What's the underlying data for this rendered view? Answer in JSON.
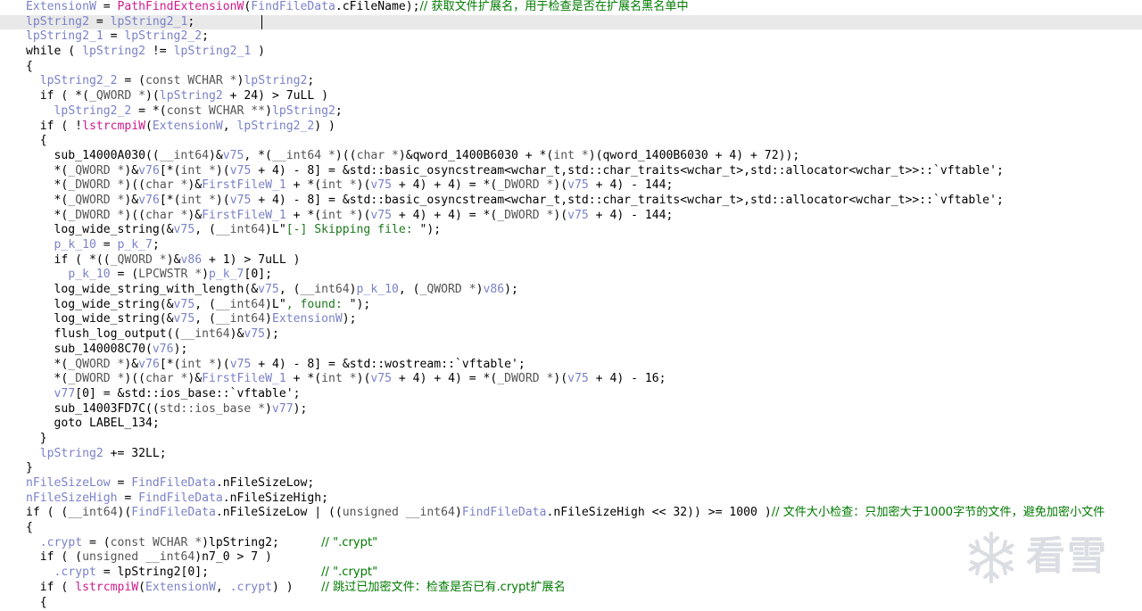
{
  "editor": {
    "current_line_index": 1,
    "lines": [
      [
        [
          "ExtensionW",
          "var"
        ],
        [
          " = ",
          "plain"
        ],
        [
          "PathFindExtensionW",
          "api"
        ],
        [
          "(",
          "plain"
        ],
        [
          "FindFileData",
          "var"
        ],
        [
          ".cFileName);",
          "plain"
        ],
        [
          "// 获取文件扩展名，用于检查是否在扩展名黑名单中",
          "comment"
        ]
      ],
      [
        [
          "lpString2",
          "var"
        ],
        [
          " = ",
          "plain"
        ],
        [
          "lpString2_1",
          "var"
        ],
        [
          ";",
          "plain"
        ]
      ],
      [
        [
          "lpString2_1",
          "var"
        ],
        [
          " = ",
          "plain"
        ],
        [
          "lpString2_2",
          "var"
        ],
        [
          ";",
          "plain"
        ]
      ],
      [
        [
          "while ( ",
          "plain"
        ],
        [
          "lpString2",
          "var"
        ],
        [
          " != ",
          "plain"
        ],
        [
          "lpString2_1",
          "var"
        ],
        [
          " )",
          "plain"
        ]
      ],
      [
        [
          "{",
          "plain"
        ]
      ],
      [
        [
          "  ",
          "plain"
        ],
        [
          "lpString2_2",
          "var"
        ],
        [
          " = (",
          "plain"
        ],
        [
          "const WCHAR *",
          "type"
        ],
        [
          ")",
          "plain"
        ],
        [
          "lpString2",
          "var"
        ],
        [
          ";",
          "plain"
        ]
      ],
      [
        [
          "  if ( *(",
          "plain"
        ],
        [
          "_QWORD *",
          "type"
        ],
        [
          ")(",
          "plain"
        ],
        [
          "lpString2",
          "var"
        ],
        [
          " + 24) > 7uLL )",
          "plain"
        ]
      ],
      [
        [
          "    ",
          "plain"
        ],
        [
          "lpString2_2",
          "var"
        ],
        [
          " = *(",
          "plain"
        ],
        [
          "const WCHAR **",
          "type"
        ],
        [
          ")",
          "plain"
        ],
        [
          "lpString2",
          "var"
        ],
        [
          ";",
          "plain"
        ]
      ],
      [
        [
          "  if ( !",
          "plain"
        ],
        [
          "lstrcmpiW",
          "api"
        ],
        [
          "(",
          "plain"
        ],
        [
          "ExtensionW",
          "var"
        ],
        [
          ", ",
          "plain"
        ],
        [
          "lpString2_2",
          "var"
        ],
        [
          ") )",
          "plain"
        ]
      ],
      [
        [
          "  {",
          "plain"
        ]
      ],
      [
        [
          "    sub_14000A030((",
          "plain"
        ],
        [
          "__int64",
          "type"
        ],
        [
          ")&",
          "plain"
        ],
        [
          "v75",
          "var"
        ],
        [
          ", *(",
          "plain"
        ],
        [
          "__int64 *",
          "type"
        ],
        [
          ")((",
          "plain"
        ],
        [
          "char *",
          "type"
        ],
        [
          ")&qword_1400B6030 + *(",
          "plain"
        ],
        [
          "int *",
          "type"
        ],
        [
          ")(qword_1400B6030 + 4) + 72));",
          "plain"
        ]
      ],
      [
        [
          "    *(",
          "plain"
        ],
        [
          "_QWORD *",
          "type"
        ],
        [
          ")&",
          "plain"
        ],
        [
          "v76",
          "var"
        ],
        [
          "[*(",
          "plain"
        ],
        [
          "int *",
          "type"
        ],
        [
          ")(",
          "plain"
        ],
        [
          "v75",
          "var"
        ],
        [
          " + 4) - 8] = &std::basic_osyncstream<wchar_t,std::char_traits<wchar_t>,std::allocator<wchar_t>>::`vftable';",
          "plain"
        ]
      ],
      [
        [
          "    *(",
          "plain"
        ],
        [
          "_DWORD *",
          "type"
        ],
        [
          ")((",
          "plain"
        ],
        [
          "char *",
          "type"
        ],
        [
          ")&",
          "plain"
        ],
        [
          "FirstFileW_1",
          "var"
        ],
        [
          " + *(",
          "plain"
        ],
        [
          "int *",
          "type"
        ],
        [
          ")(",
          "plain"
        ],
        [
          "v75",
          "var"
        ],
        [
          " + 4) + 4) = *(",
          "plain"
        ],
        [
          "_DWORD *",
          "type"
        ],
        [
          ")(",
          "plain"
        ],
        [
          "v75",
          "var"
        ],
        [
          " + 4) - 144;",
          "plain"
        ]
      ],
      [
        [
          "    *(",
          "plain"
        ],
        [
          "_QWORD *",
          "type"
        ],
        [
          ")&",
          "plain"
        ],
        [
          "v76",
          "var"
        ],
        [
          "[*(",
          "plain"
        ],
        [
          "int *",
          "type"
        ],
        [
          ")(",
          "plain"
        ],
        [
          "v75",
          "var"
        ],
        [
          " + 4) - 8] = &std::basic_osyncstream<wchar_t,std::char_traits<wchar_t>,std::allocator<wchar_t>>::`vftable';",
          "plain"
        ]
      ],
      [
        [
          "    *(",
          "plain"
        ],
        [
          "_DWORD *",
          "type"
        ],
        [
          ")((",
          "plain"
        ],
        [
          "char *",
          "type"
        ],
        [
          ")&",
          "plain"
        ],
        [
          "FirstFileW_1",
          "var"
        ],
        [
          " + *(",
          "plain"
        ],
        [
          "int *",
          "type"
        ],
        [
          ")(",
          "plain"
        ],
        [
          "v75",
          "var"
        ],
        [
          " + 4) + 4) = *(",
          "plain"
        ],
        [
          "_DWORD *",
          "type"
        ],
        [
          ")(",
          "plain"
        ],
        [
          "v75",
          "var"
        ],
        [
          " + 4) - 144;",
          "plain"
        ]
      ],
      [
        [
          "    log_wide_string(&",
          "plain"
        ],
        [
          "v75",
          "var"
        ],
        [
          ", (",
          "plain"
        ],
        [
          "__int64",
          "type"
        ],
        [
          ")L\"",
          "plain"
        ],
        [
          "[-] Skipping file: ",
          "str"
        ],
        [
          "\");",
          "plain"
        ]
      ],
      [
        [
          "    ",
          "plain"
        ],
        [
          "p_k_10",
          "var"
        ],
        [
          " = ",
          "plain"
        ],
        [
          "p_k_7",
          "var"
        ],
        [
          ";",
          "plain"
        ]
      ],
      [
        [
          "    if ( *((",
          "plain"
        ],
        [
          "_QWORD *",
          "type"
        ],
        [
          ")&",
          "plain"
        ],
        [
          "v86",
          "var"
        ],
        [
          " + 1) > 7uLL )",
          "plain"
        ]
      ],
      [
        [
          "      ",
          "plain"
        ],
        [
          "p_k_10",
          "var"
        ],
        [
          " = (",
          "plain"
        ],
        [
          "LPCWSTR *",
          "type"
        ],
        [
          ")",
          "plain"
        ],
        [
          "p_k_7",
          "var"
        ],
        [
          "[0];",
          "plain"
        ]
      ],
      [
        [
          "    log_wide_string_with_length(&",
          "plain"
        ],
        [
          "v75",
          "var"
        ],
        [
          ", (",
          "plain"
        ],
        [
          "__int64",
          "type"
        ],
        [
          ")",
          "plain"
        ],
        [
          "p_k_10",
          "var"
        ],
        [
          ", (",
          "plain"
        ],
        [
          "_QWORD *",
          "type"
        ],
        [
          ")",
          "plain"
        ],
        [
          "v86",
          "var"
        ],
        [
          ");",
          "plain"
        ]
      ],
      [
        [
          "    log_wide_string(&",
          "plain"
        ],
        [
          "v75",
          "var"
        ],
        [
          ", (",
          "plain"
        ],
        [
          "__int64",
          "type"
        ],
        [
          ")L\"",
          "plain"
        ],
        [
          ", found: ",
          "str"
        ],
        [
          "\");",
          "plain"
        ]
      ],
      [
        [
          "    log_wide_string(&",
          "plain"
        ],
        [
          "v75",
          "var"
        ],
        [
          ", (",
          "plain"
        ],
        [
          "__int64",
          "type"
        ],
        [
          ")",
          "plain"
        ],
        [
          "ExtensionW",
          "var"
        ],
        [
          ");",
          "plain"
        ]
      ],
      [
        [
          "    flush_log_output((",
          "plain"
        ],
        [
          "__int64",
          "type"
        ],
        [
          ")&",
          "plain"
        ],
        [
          "v75",
          "var"
        ],
        [
          ");",
          "plain"
        ]
      ],
      [
        [
          "    sub_140008C70(",
          "plain"
        ],
        [
          "v76",
          "var"
        ],
        [
          ");",
          "plain"
        ]
      ],
      [
        [
          "    *(",
          "plain"
        ],
        [
          "_QWORD *",
          "type"
        ],
        [
          ")&",
          "plain"
        ],
        [
          "v76",
          "var"
        ],
        [
          "[*(",
          "plain"
        ],
        [
          "int *",
          "type"
        ],
        [
          ")(",
          "plain"
        ],
        [
          "v75",
          "var"
        ],
        [
          " + 4) - 8] = &std::wostream::`vftable';",
          "plain"
        ]
      ],
      [
        [
          "    *(",
          "plain"
        ],
        [
          "_DWORD *",
          "type"
        ],
        [
          ")((",
          "plain"
        ],
        [
          "char *",
          "type"
        ],
        [
          ")&",
          "plain"
        ],
        [
          "FirstFileW_1",
          "var"
        ],
        [
          " + *(",
          "plain"
        ],
        [
          "int *",
          "type"
        ],
        [
          ")(",
          "plain"
        ],
        [
          "v75",
          "var"
        ],
        [
          " + 4) + 4) = *(",
          "plain"
        ],
        [
          "_DWORD *",
          "type"
        ],
        [
          ")(",
          "plain"
        ],
        [
          "v75",
          "var"
        ],
        [
          " + 4) - 16;",
          "plain"
        ]
      ],
      [
        [
          "    ",
          "plain"
        ],
        [
          "v77",
          "var"
        ],
        [
          "[0] = &std::ios_base::`vftable';",
          "plain"
        ]
      ],
      [
        [
          "    sub_14003FD7C((",
          "plain"
        ],
        [
          "std::ios_base *",
          "type"
        ],
        [
          ")",
          "plain"
        ],
        [
          "v77",
          "var"
        ],
        [
          ");",
          "plain"
        ]
      ],
      [
        [
          "    goto LABEL_134;",
          "plain"
        ]
      ],
      [
        [
          "  }",
          "plain"
        ]
      ],
      [
        [
          "  ",
          "plain"
        ],
        [
          "lpString2",
          "var"
        ],
        [
          " += 32LL;",
          "plain"
        ]
      ],
      [
        [
          "}",
          "plain"
        ]
      ],
      [
        [
          "nFileSizeLow",
          "var"
        ],
        [
          " = ",
          "plain"
        ],
        [
          "FindFileData",
          "var"
        ],
        [
          ".nFileSizeLow;",
          "plain"
        ]
      ],
      [
        [
          "nFileSizeHigh",
          "var"
        ],
        [
          " = ",
          "plain"
        ],
        [
          "FindFileData",
          "var"
        ],
        [
          ".nFileSizeHigh;",
          "plain"
        ]
      ],
      [
        [
          "if ( (",
          "plain"
        ],
        [
          "__int64",
          "type"
        ],
        [
          ")(",
          "plain"
        ],
        [
          "FindFileData",
          "var"
        ],
        [
          ".nFileSizeLow | ((",
          "plain"
        ],
        [
          "unsigned __int64",
          "type"
        ],
        [
          ")",
          "plain"
        ],
        [
          "FindFileData",
          "var"
        ],
        [
          ".nFileSizeHigh << 32)) >= 1000 )",
          "plain"
        ],
        [
          "// 文件大小检查：只加密大于1000字节的文件，避免加密小文件",
          "comment"
        ]
      ],
      [
        [
          "{",
          "plain"
        ]
      ],
      [
        [
          "  ",
          "plain"
        ],
        [
          ".crypt",
          "var"
        ],
        [
          " = (",
          "plain"
        ],
        [
          "const WCHAR *",
          "type"
        ],
        [
          ")lpString2;      ",
          "plain"
        ],
        [
          "// \".crypt\"",
          "comment"
        ]
      ],
      [
        [
          "  if ( (",
          "plain"
        ],
        [
          "unsigned __int64",
          "type"
        ],
        [
          ")n7_0 > 7 )",
          "plain"
        ]
      ],
      [
        [
          "    ",
          "plain"
        ],
        [
          ".crypt",
          "var"
        ],
        [
          " = lpString2[0];                ",
          "plain"
        ],
        [
          "// \".crypt\"",
          "comment"
        ]
      ],
      [
        [
          "  if ( ",
          "plain"
        ],
        [
          "lstrcmpiW",
          "api"
        ],
        [
          "(",
          "plain"
        ],
        [
          "ExtensionW",
          "var"
        ],
        [
          ", ",
          "plain"
        ],
        [
          ".crypt",
          "var"
        ],
        [
          ") )    ",
          "plain"
        ],
        [
          "// 跳过已加密文件：检查是否已有.crypt扩展名",
          "comment"
        ]
      ],
      [
        [
          "  {",
          "plain"
        ]
      ]
    ]
  },
  "watermark": {
    "icon": "snowflake-icon",
    "text": "看雪",
    "color": "#bcc3cc"
  }
}
